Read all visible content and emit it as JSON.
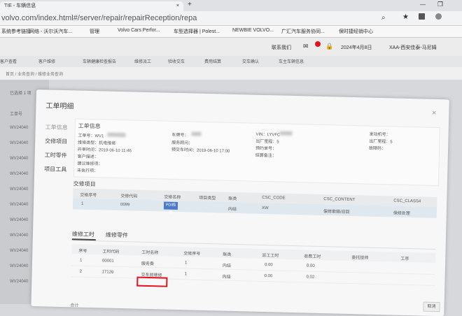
{
  "browser": {
    "tab_title": "TIE - 车辆信息",
    "new_tab": "+",
    "url": "volvo.com/index.html#/server/repair/repairReception/repa",
    "bookmarks": [
      "系统参考链接",
      "网络 - 沃尔沃汽车...",
      "管理",
      "Volvo Cars Perfor...",
      "车型选择器 | Polest...",
      "NEWBIE VOLVO...",
      "广汇汽车服务协同...",
      "保时捷经销中心"
    ]
  },
  "app": {
    "header_links": [
      "联系我们",
      "",
      "2024年4月8日",
      "XAA-西安佳泰-马尼姆"
    ],
    "tabs": [
      "客户查看",
      "客户维修",
      "车辆健康检查报告",
      "维修派工",
      "验收交车",
      "费用结算",
      "交车确认",
      "车主车辆信息"
    ],
    "breadcrumb": "首页 / 业务查询 / 维修业务查询",
    "left_list": [
      "工单号",
      "WV24040",
      "WV24040",
      "WV24040",
      "WV24040",
      "WV24040",
      "WV24040",
      "WV24040",
      "WV24040",
      "WV24040",
      "WV24040",
      "WV24040"
    ],
    "left_meta": "已选择 1 项"
  },
  "modal": {
    "title": "工单明细",
    "close": "×",
    "side_nav": [
      "工单信息",
      "交修项目",
      "工时零件",
      "项目工具"
    ],
    "info_title": "工单信息",
    "info": {
      "order_no_label": "工单号：WV1",
      "repair_type": "维修类型：机电维修",
      "open_time": "开单时间：2019-06-10 11:46",
      "customer_desc": "客户描述：",
      "suggest": "建议维修项：",
      "not_done": "未执行项：",
      "vehicle_no": "车牌号：",
      "advisor": "服务顾问：",
      "pickup": "预交车时间：2019-06-10 17:00",
      "vin": "VIN：LYVFC",
      "mileage": "出厂里程：5",
      "settle_no": "预约单号：",
      "settle_remark": "结算备注：",
      "engine_no": "发动机号：",
      "factory": "出厂里程：5",
      "fault": "故障码："
    },
    "job_section": "交修项目",
    "job_headers": [
      "交修序号",
      "交修代码",
      "交修名称",
      "项目类型",
      "账类",
      "CSC_CODE",
      "CSC_CONTENT",
      "CSC_CLASS4"
    ],
    "job_row": [
      "1",
      "0099",
      "PDI检查",
      "",
      "内结",
      "XW",
      "保修索赔/召回",
      "保修处理"
    ],
    "subtabs": [
      "维修工时",
      "维修零件"
    ],
    "labor_headers": [
      "序号",
      "工时代码",
      "工时名称",
      "交修序号",
      "账类",
      "派工工时",
      "收费工时",
      "委托技师",
      "工序"
    ],
    "labor_rows": [
      [
        "1",
        "00001",
        "服务费",
        "1",
        "内结",
        "0.00",
        "0.00",
        "",
        ""
      ],
      [
        "2",
        "17120",
        "交车前维修",
        "1",
        "内结",
        "0.00",
        "0.02",
        "",
        ""
      ]
    ],
    "footer": "合计",
    "ok": "取消"
  }
}
